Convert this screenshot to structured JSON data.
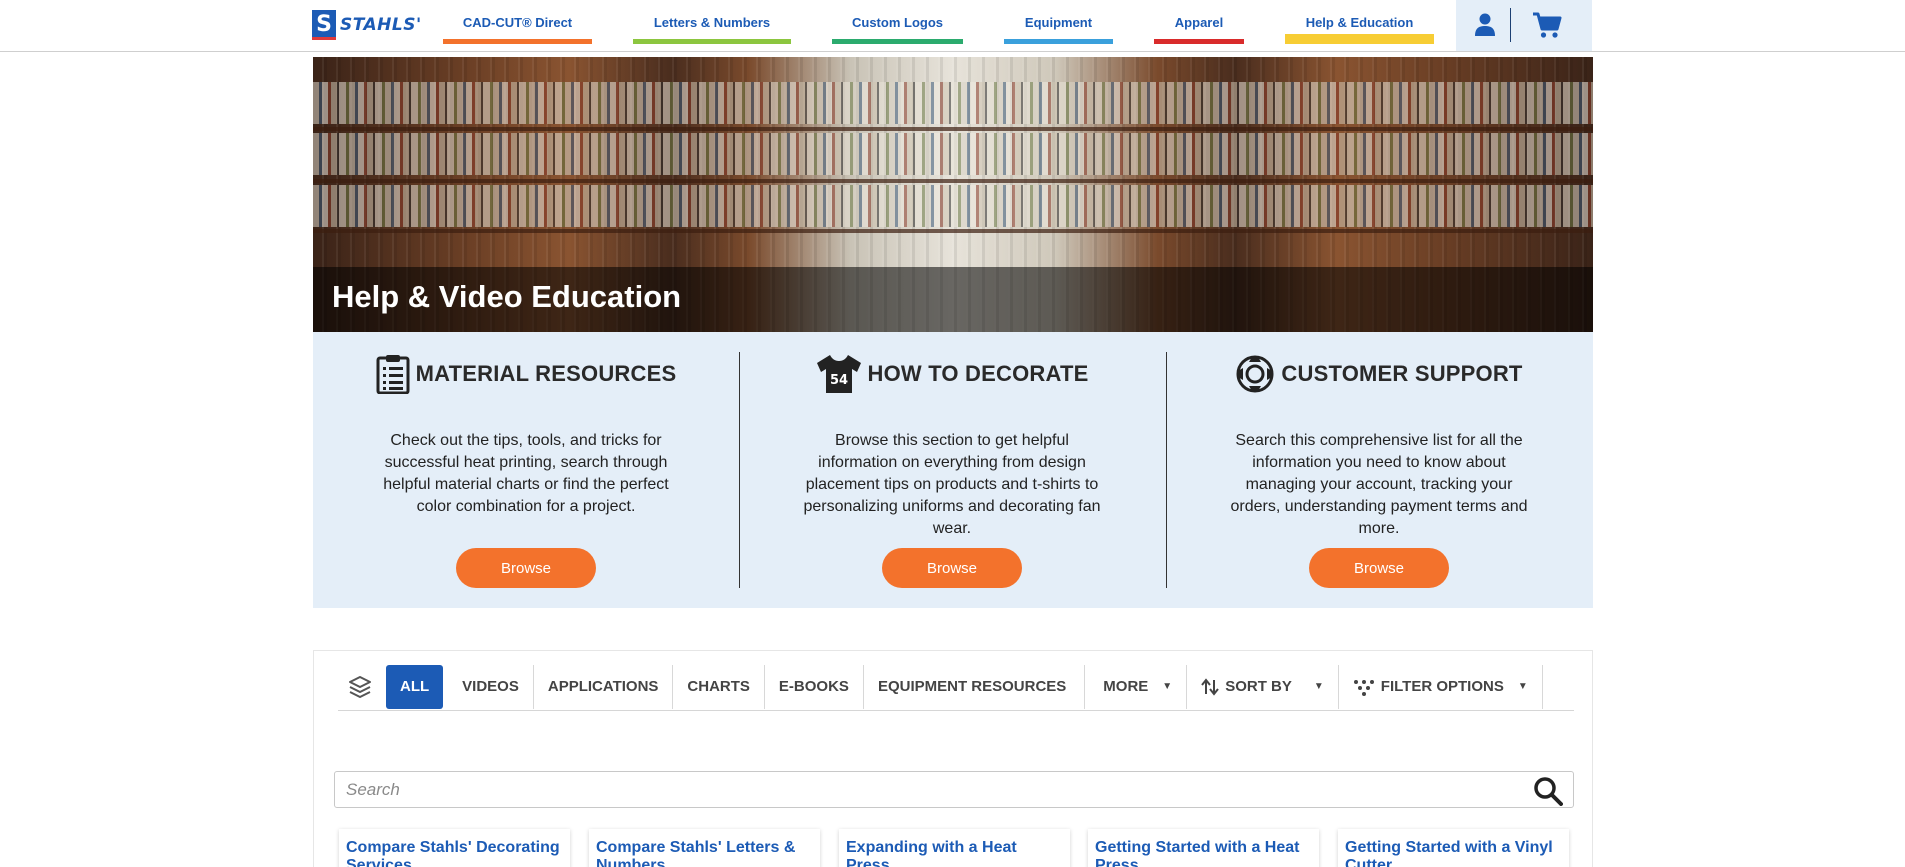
{
  "header": {
    "logo_text": "STAHLS'",
    "nav": [
      {
        "label": "CAD-CUT® Direct",
        "color": "#f3722c"
      },
      {
        "label": "Letters & Numbers",
        "color": "#8cc63f"
      },
      {
        "label": "Custom Logos",
        "color": "#2bab6e"
      },
      {
        "label": "Equipment",
        "color": "#3aa0dc"
      },
      {
        "label": "Apparel",
        "color": "#d92b2b"
      },
      {
        "label": "Help & Education",
        "color": "#f7cd34"
      }
    ],
    "account_icon": "user-icon",
    "cart_icon": "cart-icon"
  },
  "hero": {
    "title": "Help & Video Education"
  },
  "resources": [
    {
      "icon": "clipboard-list-icon",
      "title": "MATERIAL RESOURCES",
      "description": "Check out the tips, tools, and tricks for successful heat printing, search through helpful material charts or find the perfect color combination for a project.",
      "button": "Browse"
    },
    {
      "icon": "jersey-icon",
      "jersey_number": "54",
      "title": "HOW TO DECORATE",
      "description": "Browse this section to get helpful information on everything from design placement tips on products and t-shirts to personalizing uniforms and decorating fan wear.",
      "button": "Browse"
    },
    {
      "icon": "life-ring-icon",
      "title": "CUSTOMER SUPPORT",
      "description": "Search this comprehensive list for all the information you need to know about managing your account, tracking your orders, understanding payment terms and more.",
      "button": "Browse"
    }
  ],
  "library": {
    "tabs": [
      "ALL",
      "VIDEOS",
      "APPLICATIONS",
      "CHARTS",
      "E-BOOKS",
      "EQUIPMENT RESOURCES"
    ],
    "active_tab": "ALL",
    "more_label": "MORE",
    "sort_label": "SORT BY",
    "filter_label": "FILTER OPTIONS",
    "search_placeholder": "Search",
    "cards": [
      "Compare Stahls' Decorating Services",
      "Compare Stahls' Letters & Numbers",
      "Expanding with a Heat Press",
      "Getting Started with a Heat Press",
      "Getting Started with a Vinyl Cutter"
    ]
  },
  "colors": {
    "brand_blue": "#1c5bb5",
    "accent_orange": "#f3722c",
    "panel_bg": "#e4eef8"
  }
}
